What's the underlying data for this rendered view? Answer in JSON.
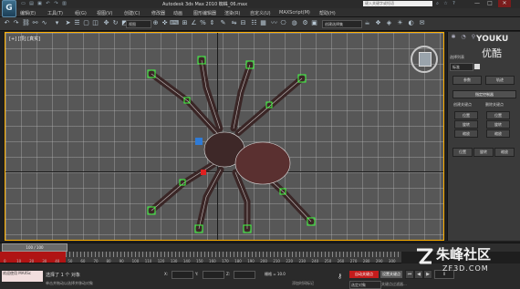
{
  "window": {
    "app_logo": "G",
    "title": "Autodesk 3ds Max 2010   蜘蛛_06.max",
    "search_placeholder": "键入关键字或短语",
    "minimize": "—",
    "maximize": "□",
    "close": "✕"
  },
  "menu": {
    "items": [
      "编辑(E)",
      "工具(T)",
      "组(G)",
      "视图(V)",
      "创建(C)",
      "修改器",
      "动画",
      "图形编辑器",
      "渲染(R)",
      "自定义(U)",
      "MAXScript(M)",
      "帮助(H)"
    ]
  },
  "toolbar": {
    "view_dropdown": "视图",
    "selection_set_dropdown": "创建选择集"
  },
  "viewport": {
    "label": "[+] [顶] [真实]",
    "border_color": "#ffb000",
    "grid_color": "#575757"
  },
  "command_panel": {
    "youku_brand": "YOUKU",
    "youku_cn": "优酷",
    "object_name_label": "选择列表",
    "object_name_value": "标准",
    "btn_param": "参数",
    "btn_track": "轨迹",
    "rollout_title": "指定控制器",
    "create_key_label": "创建关键点",
    "delete_key_label": "删除关键点",
    "key_buttons": [
      "位置",
      "旋转",
      "缩放"
    ],
    "key_buttons_right": [
      "位置",
      "旋转",
      "缩放"
    ],
    "bottom_tabs": [
      "位置",
      "旋转",
      "缩放"
    ]
  },
  "timeline": {
    "slider_text": "100 / 100",
    "tick_labels": [
      "0",
      "10",
      "20",
      "30",
      "40",
      "50",
      "60",
      "70",
      "80",
      "90",
      "100",
      "110",
      "120",
      "130",
      "140",
      "150",
      "160",
      "170",
      "180",
      "190",
      "200",
      "210",
      "220",
      "230",
      "240",
      "250",
      "260",
      "270",
      "280",
      "290",
      "300"
    ]
  },
  "status": {
    "maxscript_text": "欢迎使用 MAXSc",
    "selection_text": "选择了 1 个 对象",
    "prompt_text": "单击并拖动以选择并移动对象",
    "x_label": "X:",
    "y_label": "Y:",
    "z_label": "Z:",
    "grid_text": "栅格 = 10.0",
    "add_time_tag": "添加时间标记",
    "auto_key": "自动关键点",
    "set_key": "设置关键点",
    "selected_dropdown": "选定对象",
    "frame_value": "0",
    "key_filters": "关键点过滤器..."
  },
  "watermark": {
    "cn": "朱峰社区",
    "url": "ZF3D.COM"
  }
}
